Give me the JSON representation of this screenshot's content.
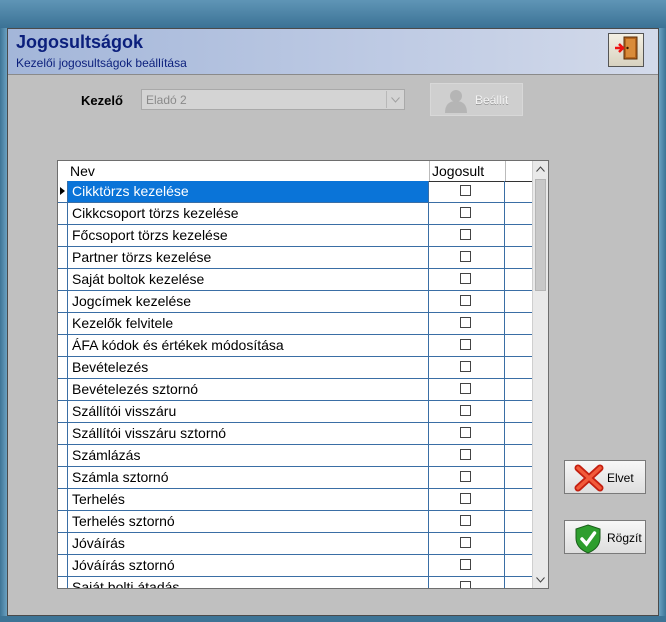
{
  "header": {
    "title": "Jogosultságok",
    "subtitle": "Kezelői jogosultságok beállítása"
  },
  "kezelo": {
    "label": "Kezelő",
    "selected": "Eladó 2",
    "apply_label": "Beállít"
  },
  "grid": {
    "columns": [
      "Nev",
      "Jogosult"
    ],
    "rows": [
      {
        "name": "Cikktörzs kezelése",
        "checked": false,
        "selected": true
      },
      {
        "name": "Cikkcsoport törzs kezelése",
        "checked": false
      },
      {
        "name": "Főcsoport törzs kezelése",
        "checked": false
      },
      {
        "name": "Partner törzs kezelése",
        "checked": false
      },
      {
        "name": "Saját boltok kezelése",
        "checked": false
      },
      {
        "name": "Jogcímek kezelése",
        "checked": false
      },
      {
        "name": "Kezelők felvitele",
        "checked": false
      },
      {
        "name": "ÁFA kódok és értékek módosítása",
        "checked": false
      },
      {
        "name": "Bevételezés",
        "checked": false
      },
      {
        "name": "Bevételezés sztornó",
        "checked": false
      },
      {
        "name": "Szállítói visszáru",
        "checked": false
      },
      {
        "name": "Szállítói visszáru sztornó",
        "checked": false
      },
      {
        "name": "Számlázás",
        "checked": false
      },
      {
        "name": "Számla sztornó",
        "checked": false
      },
      {
        "name": "Terhelés",
        "checked": false
      },
      {
        "name": "Terhelés sztornó",
        "checked": false
      },
      {
        "name": "Jóváírás",
        "checked": false
      },
      {
        "name": "Jóváírás sztornó",
        "checked": false
      },
      {
        "name": "Saját bolti átadás",
        "checked": false
      }
    ]
  },
  "actions": {
    "reject_label": "Elvet",
    "save_label": "Rögzít"
  },
  "colors": {
    "title": "#0b1f7c",
    "selection": "#0a74d8",
    "grid_line": "#3a6ea5"
  },
  "icons": [
    "exit-door-icon",
    "user-icon",
    "red-x-icon",
    "green-shield-check-icon"
  ]
}
